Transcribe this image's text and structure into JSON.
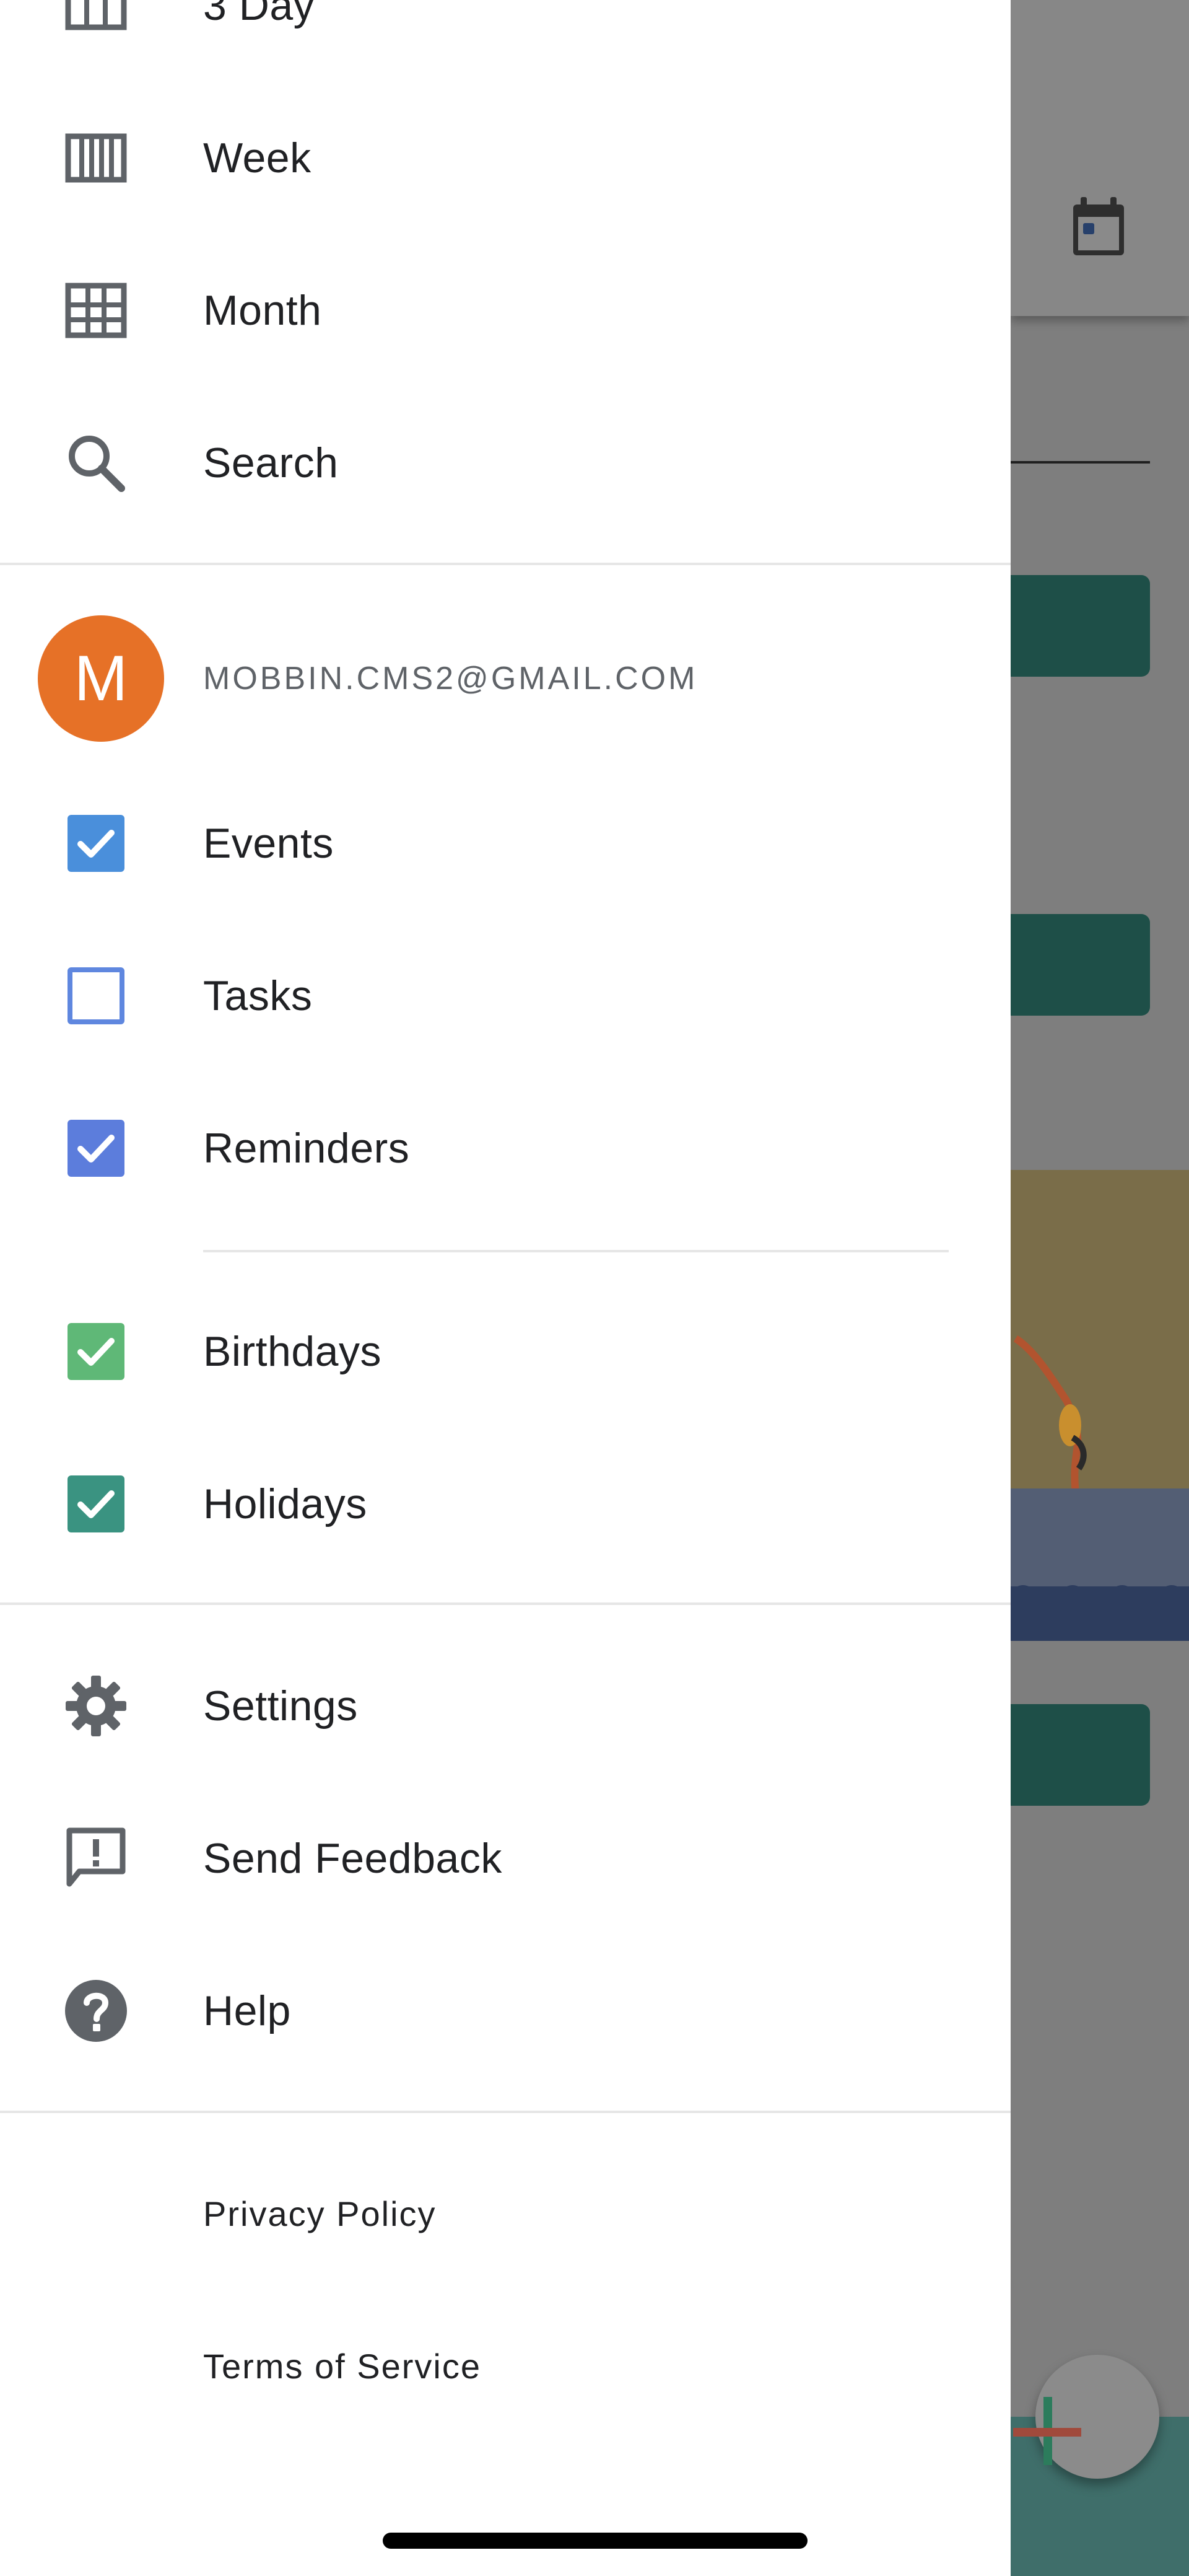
{
  "views": [
    {
      "id": "3day",
      "label": "3 Day",
      "icon": "three-day-view-icon"
    },
    {
      "id": "week",
      "label": "Week",
      "icon": "week-view-icon"
    },
    {
      "id": "month",
      "label": "Month",
      "icon": "month-view-icon"
    },
    {
      "id": "search",
      "label": "Search",
      "icon": "search-icon"
    }
  ],
  "account": {
    "avatar_initial": "M",
    "avatar_color": "#e67127",
    "email": "MOBBIN.CMS2@GMAIL.COM"
  },
  "calendars": [
    {
      "label": "Events",
      "checked": true,
      "color": "#4a8fdb"
    },
    {
      "label": "Tasks",
      "checked": false,
      "color": "#5f87df"
    },
    {
      "label": "Reminders",
      "checked": true,
      "color": "#5c7ddc"
    }
  ],
  "other_calendars": [
    {
      "label": "Birthdays",
      "checked": true,
      "color": "#5fb877"
    },
    {
      "label": "Holidays",
      "checked": true,
      "color": "#3a9381"
    }
  ],
  "menu": [
    {
      "label": "Settings",
      "icon": "gear-icon"
    },
    {
      "label": "Send Feedback",
      "icon": "feedback-icon"
    },
    {
      "label": "Help",
      "icon": "help-icon"
    }
  ],
  "footer": {
    "privacy": "Privacy Policy",
    "terms": "Terms of Service"
  }
}
